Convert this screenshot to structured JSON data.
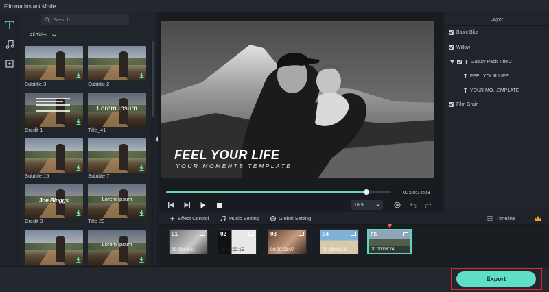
{
  "app": {
    "title": "Filmora Instant Mode"
  },
  "window_controls": [
    "save-icon",
    "menu-icon",
    "minimize-icon",
    "restore-icon",
    "close-icon"
  ],
  "tools": [
    {
      "name": "titles-tool",
      "glyph": "T",
      "active": true
    },
    {
      "name": "music-tool",
      "glyph": "♫",
      "active": false
    },
    {
      "name": "elements-tool",
      "glyph": "⊡",
      "active": false
    }
  ],
  "library": {
    "search_placeholder": "Search",
    "filter_label": "All Titles",
    "items": [
      {
        "caption": "Subtitle 3",
        "overlay": ""
      },
      {
        "caption": "Subtitle 2",
        "overlay": ""
      },
      {
        "caption": "Credit 1",
        "overlay": "credits"
      },
      {
        "caption": "Title_41",
        "overlay": "Lorem Ipsum"
      },
      {
        "caption": "Subtitle 15",
        "overlay": ""
      },
      {
        "caption": "Subtitle 7",
        "overlay": ""
      },
      {
        "caption": "Credit 3",
        "overlay": "Joe Bloggs"
      },
      {
        "caption": "Title 29",
        "overlay": "Lorem Ipsum"
      },
      {
        "caption": "",
        "overlay": ""
      },
      {
        "caption": "",
        "overlay": "Lorem Ipsum"
      }
    ]
  },
  "preview": {
    "title_text": "FEEL YOUR LIFE",
    "subtitle_text": "YOUR MOMENTS TEMPLATE",
    "timecode": "00:00:14:03",
    "progress_fraction": 0.89,
    "aspect_ratio": "16:9"
  },
  "layers": {
    "header": "Layer",
    "items": [
      {
        "label": "Basic Blur",
        "kind": "check",
        "indent": 0
      },
      {
        "label": "Willow",
        "kind": "check",
        "indent": 0
      },
      {
        "label": "Galaxy Pack Title 2",
        "kind": "group",
        "indent": 0
      },
      {
        "label": "FEEL YOUR LIFE",
        "kind": "text",
        "indent": 1
      },
      {
        "label": "YOUR MO...EMPLATE",
        "kind": "text",
        "indent": 1
      },
      {
        "label": "Film Grain",
        "kind": "check",
        "indent": 0
      }
    ]
  },
  "tabs": {
    "effect_control": "Effect Control",
    "music_setting": "Music Setting",
    "global_setting": "Global Setting",
    "timeline": "Timeline"
  },
  "clips": [
    {
      "num": "01",
      "duration": "00:00:03:21",
      "selected": false
    },
    {
      "num": "02",
      "duration": "00:00:02:15",
      "selected": false
    },
    {
      "num": "03",
      "duration": "00:00:03:07",
      "selected": false
    },
    {
      "num": "04",
      "duration": "00:00:03:18",
      "selected": false
    },
    {
      "num": "05",
      "duration": "00:00:03:24",
      "selected": true
    }
  ],
  "footer": {
    "export_label": "Export"
  },
  "colors": {
    "accent": "#5fe0c6",
    "highlight": "#e0242f",
    "playhead": "#ff5d5d"
  }
}
